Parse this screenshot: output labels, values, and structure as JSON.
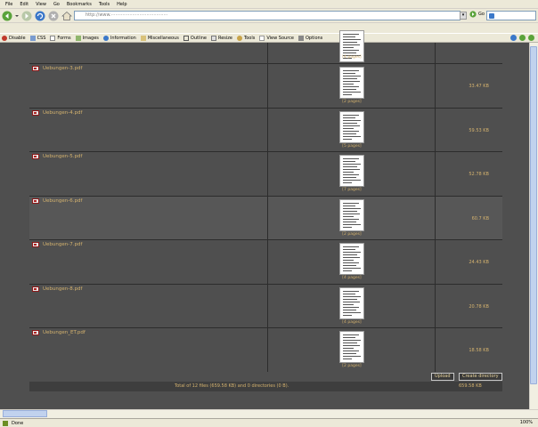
{
  "menu": [
    "File",
    "Edit",
    "View",
    "Go",
    "Bookmarks",
    "Tools",
    "Help"
  ],
  "nav": {
    "url": "http://www.········································",
    "url_dropdown": "▾",
    "go_label": "Go",
    "search_placeholder": ""
  },
  "devbar": [
    "Disable",
    "CSS",
    "Forms",
    "Images",
    "Information",
    "Miscellaneous",
    "Outline",
    "Resize",
    "Tools",
    "View Source",
    "Options"
  ],
  "files": [
    {
      "name": "",
      "pages": "[4 pages]",
      "size": "",
      "partial": true
    },
    {
      "name": "Uebungen-3.pdf",
      "pages": "[2 pages]",
      "size": "33.47 KB"
    },
    {
      "name": "Uebungen-4.pdf",
      "pages": "[5 pages]",
      "size": "59.53 KB"
    },
    {
      "name": "Uebungen-5.pdf",
      "pages": "[7 pages]",
      "size": "52.78 KB"
    },
    {
      "name": "Uebungen-6.pdf",
      "pages": "[2 pages]",
      "size": "60.7 KB"
    },
    {
      "name": "Uebungen-7.pdf",
      "pages": "[4 pages]",
      "size": "24.43 KB"
    },
    {
      "name": "Uebungen-8.pdf",
      "pages": "[4 pages]",
      "size": "20.78 KB"
    },
    {
      "name": "Uebungen_ET.pdf",
      "pages": "[2 pages]",
      "size": "18.58 KB"
    }
  ],
  "actions": {
    "upload": "Upload",
    "create_directory": "Create directory"
  },
  "footer": {
    "summary": "Total of 12 files (659.58 KB) and 0 directories (0 B).",
    "total": "659.58 KB"
  },
  "status": {
    "text": "Done",
    "zoom": "100%"
  },
  "colors": {
    "accent": "#d4b26e",
    "page_bg": "#4f4f4f",
    "footer_bg": "#3e3e3e"
  }
}
